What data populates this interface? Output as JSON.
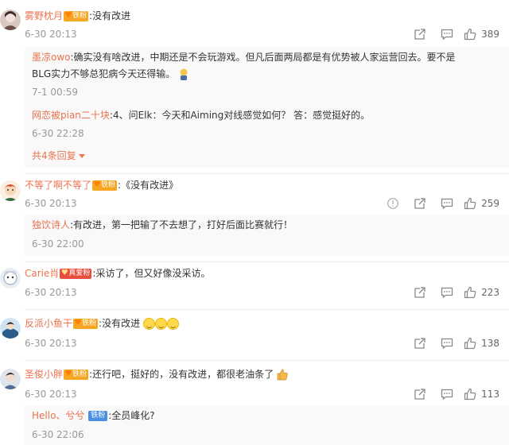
{
  "comments": [
    {
      "user": "雾野枕月",
      "badge": "铁粉",
      "text": ":没有改进",
      "time": "6-30 20:13",
      "likes": "389",
      "replies": [
        {
          "user": "墨凉owo",
          "text_line1": ":确实没有啥改进，中期还是不会玩游戏。但凡后面两局都是有优势被人家运营回去。要不是",
          "text_line2": "BLG实力不够总犯病今天还得输。",
          "time": "7-1 00:59"
        },
        {
          "user": "网恋被pian二十块",
          "text_line1": ":4、问Elk：今天和Aiming对线感觉如何？ 答：感觉挺好的。",
          "time": "6-30 22:28"
        }
      ],
      "more_replies": "共4条回复"
    },
    {
      "user": "不等了啊不等了",
      "badge": "铁粉",
      "text": ":《没有改进》",
      "time": "6-30 20:13",
      "likes": "259",
      "replies": [
        {
          "user": "独饮诗人",
          "text_line1": ":有改进，第一把输了不去想了，打好后面比赛就行！",
          "time": "6-30 22:00"
        }
      ]
    },
    {
      "user": "Carie肖",
      "badge": "真爱粉",
      "text": ":采访了，但又好像没采访。",
      "time": "6-30 20:13",
      "likes": "223"
    },
    {
      "user": "反派小鱼干",
      "badge": "铁粉",
      "text": ":没有改进",
      "time": "6-30 20:13",
      "likes": "138"
    },
    {
      "user": "圣俊小胖",
      "badge": "铁粉",
      "text": ":还行吧，挺好的，没有改进，都很老油条了",
      "time": "6-30 20:13",
      "likes": "113",
      "replies": [
        {
          "user": "Hello、兮兮",
          "badge": "铁粉",
          "text_line1": ":全员峰化?",
          "time": "6-30 22:06"
        }
      ]
    }
  ],
  "colors": {
    "username": "#eb7350",
    "muted": "#999999",
    "reply_bg": "#f9f9f9"
  },
  "icons": [
    "share-icon",
    "comment-icon",
    "like-icon",
    "report-icon",
    "emoji-icon"
  ]
}
